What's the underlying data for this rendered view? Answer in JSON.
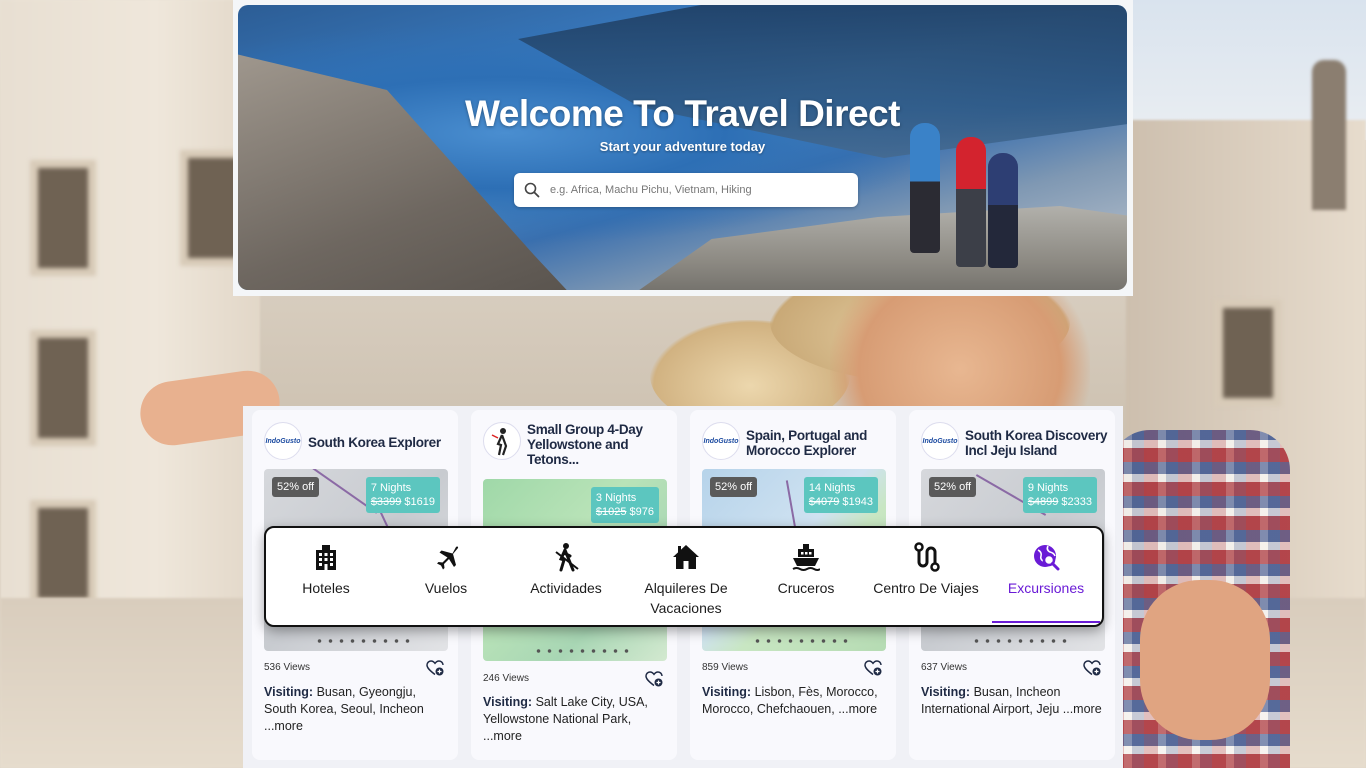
{
  "hero": {
    "title": "Welcome To Travel Direct",
    "subtitle": "Start your adventure today",
    "search_placeholder": "e.g. Africa, Machu Pichu, Vietnam, Hiking"
  },
  "nav": {
    "items": [
      {
        "label": "Hoteles",
        "icon": "building-icon",
        "active": false
      },
      {
        "label": "Vuelos",
        "icon": "plane-icon",
        "active": false
      },
      {
        "label": "Actividades",
        "icon": "hiker-icon",
        "active": false
      },
      {
        "label": "Alquileres De Vacaciones",
        "icon": "house-icon",
        "active": false
      },
      {
        "label": "Cruceros",
        "icon": "ship-icon",
        "active": false
      },
      {
        "label": "Centro De Viajes",
        "icon": "route-icon",
        "active": false
      },
      {
        "label": "Excursiones",
        "icon": "globe-search-icon",
        "active": true
      }
    ],
    "active_color": "#6a1bd6"
  },
  "cards": [
    {
      "logo_text": "IndoGusto",
      "title": "South Korea Explorer",
      "discount": "52% off",
      "nights": "7 Nights",
      "old_price": "$3399",
      "price": "$1619",
      "views": "536 Views",
      "visiting_label": "Visiting:",
      "visiting": "Busan, Gyeongju, South Korea, Seoul, Incheon",
      "more": "...more"
    },
    {
      "logo_text": "",
      "title": "Small Group 4-Day Yellowstone and Tetons...",
      "discount": "",
      "nights": "3 Nights",
      "old_price": "$1025",
      "price": "$976",
      "views": "246 Views",
      "visiting_label": "Visiting:",
      "visiting": "Salt Lake City, USA, Yellowstone National Park,",
      "more": "...more"
    },
    {
      "logo_text": "IndoGusto",
      "title": "Spain, Portugal and Morocco Explorer",
      "discount": "52% off",
      "nights": "14 Nights",
      "old_price": "$4079",
      "price": "$1943",
      "views": "859 Views",
      "visiting_label": "Visiting:",
      "visiting": "Lisbon, Fès, Morocco, Morocco, Chefchaouen,",
      "more": "...more"
    },
    {
      "logo_text": "IndoGusto",
      "title": "South Korea Discovery Incl Jeju Island",
      "discount": "52% off",
      "nights": "9 Nights",
      "old_price": "$4899",
      "price": "$2333",
      "views": "637 Views",
      "visiting_label": "Visiting:",
      "visiting": "Busan, Incheon International Airport, Jeju",
      "more": "...more"
    }
  ],
  "colors": {
    "teal_badge": "#5cc6bf",
    "title_text": "#1f2a44"
  }
}
